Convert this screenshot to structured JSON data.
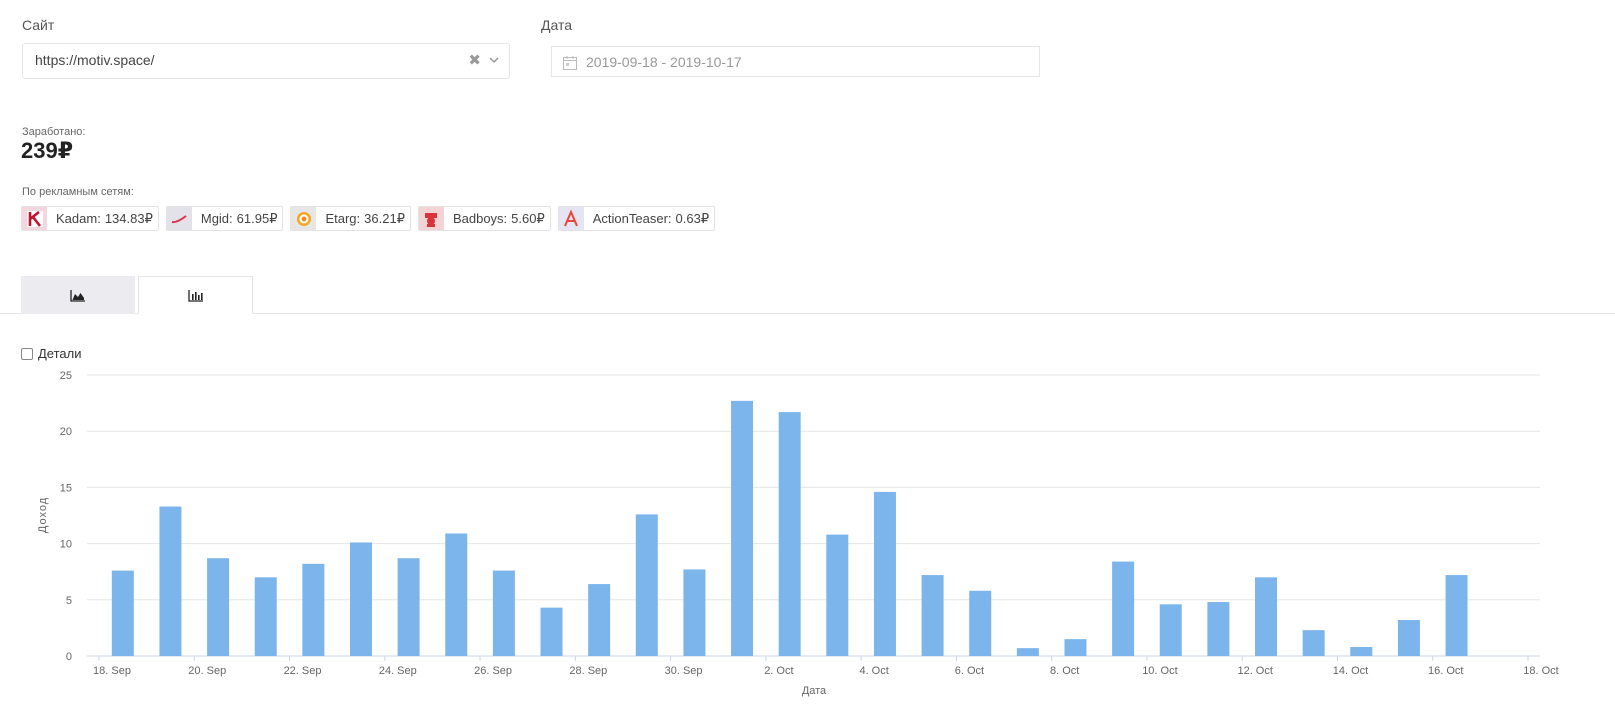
{
  "filters": {
    "site_label": "Сайт",
    "site_value": "https://motiv.space/",
    "date_label": "Дата",
    "date_value": "2019-09-18 - 2019-10-17"
  },
  "summary": {
    "earned_label": "Заработано:",
    "earned_value": "239₽",
    "networks_label": "По рекламным сетям:"
  },
  "networks": [
    {
      "name": "Kadam:",
      "amount": "134.83₽",
      "icon": "kadam-logo-icon",
      "color": "#c8102e"
    },
    {
      "name": "Mgid:",
      "amount": "61.95₽",
      "icon": "mgid-logo-icon",
      "color": "#e0314b"
    },
    {
      "name": "Etarg:",
      "amount": "36.21₽",
      "icon": "etarg-logo-icon",
      "color": "#f08a24"
    },
    {
      "name": "Badboys:",
      "amount": "5.60₽",
      "icon": "badboys-logo-icon",
      "color": "#d9343a"
    },
    {
      "name": "ActionTeaser:",
      "amount": "0.63₽",
      "icon": "actionteaser-logo-icon",
      "color": "#e8453c"
    }
  ],
  "tabs": [
    {
      "name": "area-chart-tab",
      "icon": "area-chart-icon",
      "active": false
    },
    {
      "name": "bar-chart-tab",
      "icon": "bar-chart-icon",
      "active": true
    }
  ],
  "details_label": "Детали",
  "colors": {
    "bar": "#7cb5ec",
    "grid": "#e6e6e6",
    "axis_text": "#666666"
  },
  "chart_data": {
    "type": "bar",
    "xlabel": "Дата",
    "ylabel": "Доход",
    "ylim": [
      0,
      25
    ],
    "yticks": [
      0,
      5,
      10,
      15,
      20,
      25
    ],
    "grid": true,
    "x_tick_labels": [
      "18. Sep",
      "20. Sep",
      "22. Sep",
      "24. Sep",
      "26. Sep",
      "28. Sep",
      "30. Sep",
      "2. Oct",
      "4. Oct",
      "6. Oct",
      "8. Oct",
      "10. Oct",
      "12. Oct",
      "14. Oct",
      "16. Oct",
      "18. Oct"
    ],
    "x_tick_dates": [
      "2019-09-18",
      "2019-09-20",
      "2019-09-22",
      "2019-09-24",
      "2019-09-26",
      "2019-09-28",
      "2019-09-30",
      "2019-10-02",
      "2019-10-04",
      "2019-10-06",
      "2019-10-08",
      "2019-10-10",
      "2019-10-12",
      "2019-10-14",
      "2019-10-16",
      "2019-10-18"
    ],
    "x_range": [
      "2019-09-18",
      "2019-10-18"
    ],
    "x": [
      "2019-09-18",
      "2019-09-19",
      "2019-09-20",
      "2019-09-21",
      "2019-09-22",
      "2019-09-23",
      "2019-09-24",
      "2019-09-25",
      "2019-09-26",
      "2019-09-27",
      "2019-09-28",
      "2019-09-29",
      "2019-09-30",
      "2019-10-01",
      "2019-10-02",
      "2019-10-03",
      "2019-10-04",
      "2019-10-05",
      "2019-10-06",
      "2019-10-07",
      "2019-10-08",
      "2019-10-09",
      "2019-10-10",
      "2019-10-11",
      "2019-10-12",
      "2019-10-13",
      "2019-10-14",
      "2019-10-15",
      "2019-10-16"
    ],
    "values": [
      7.6,
      13.3,
      8.7,
      7.0,
      8.2,
      10.1,
      8.7,
      10.9,
      7.6,
      4.3,
      6.4,
      12.6,
      7.7,
      22.7,
      21.7,
      10.8,
      14.6,
      7.2,
      5.8,
      0.7,
      1.5,
      8.4,
      4.6,
      4.8,
      7.0,
      2.3,
      0.8,
      3.2,
      7.2
    ]
  }
}
